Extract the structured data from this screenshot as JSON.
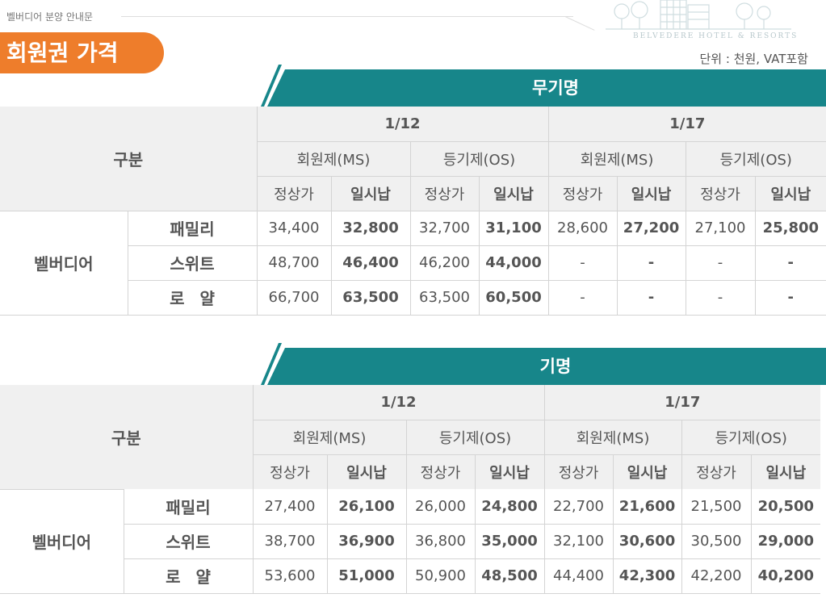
{
  "header": {
    "caption": "벨버디어 분양 안내문",
    "logo_text": "BELVEDERE HOTEL & RESORTS",
    "title": "회원권 가격",
    "unit_note": "단위 : 천원, VAT포함",
    "accent_color": "#ee7d2b",
    "teal_color": "#17868a"
  },
  "tables": [
    {
      "tab_label": "무기명",
      "group_label": "구분",
      "dates": [
        "1/12",
        "1/17"
      ],
      "types": [
        "회원제(MS)",
        "등기제(OS)",
        "회원제(MS)",
        "등기제(OS)"
      ],
      "price_labels": [
        "정상가",
        "일시납",
        "정상가",
        "일시납",
        "정상가",
        "일시납",
        "정상가",
        "일시납"
      ],
      "brand": "벨버디어",
      "rows": [
        {
          "name": "패밀리",
          "values": [
            "34,400",
            "32,800",
            "32,700",
            "31,100",
            "28,600",
            "27,200",
            "27,100",
            "25,800"
          ]
        },
        {
          "name": "스위트",
          "values": [
            "48,700",
            "46,400",
            "46,200",
            "44,000",
            "-",
            "-",
            "-",
            "-"
          ]
        },
        {
          "name": "로 얄",
          "values": [
            "66,700",
            "63,500",
            "63,500",
            "60,500",
            "-",
            "-",
            "-",
            "-"
          ]
        }
      ]
    },
    {
      "tab_label": "기명",
      "group_label": "구분",
      "dates": [
        "1/12",
        "1/17"
      ],
      "types": [
        "회원제(MS)",
        "등기제(OS)",
        "회원제(MS)",
        "등기제(OS)"
      ],
      "price_labels": [
        "정상가",
        "일시납",
        "정상가",
        "일시납",
        "정상가",
        "일시납",
        "정상가",
        "일시납"
      ],
      "brand": "벨버디어",
      "rows": [
        {
          "name": "패밀리",
          "values": [
            "27,400",
            "26,100",
            "26,000",
            "24,800",
            "22,700",
            "21,600",
            "21,500",
            "20,500"
          ]
        },
        {
          "name": "스위트",
          "values": [
            "38,700",
            "36,900",
            "36,800",
            "35,000",
            "32,100",
            "30,600",
            "30,500",
            "29,000"
          ]
        },
        {
          "name": "로 얄",
          "values": [
            "53,600",
            "51,000",
            "50,900",
            "48,500",
            "44,400",
            "42,300",
            "42,200",
            "40,200"
          ]
        }
      ]
    }
  ]
}
